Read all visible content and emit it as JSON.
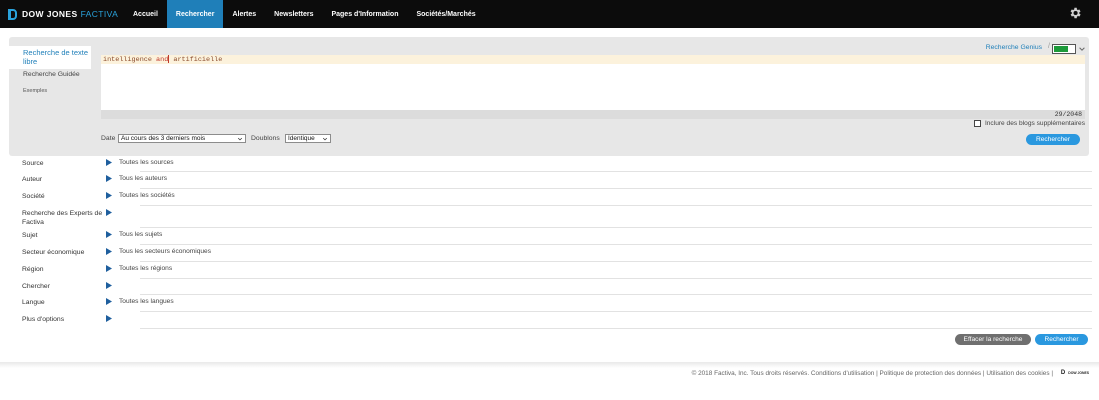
{
  "brand": {
    "name": "DOW JONES",
    "product": "FACTIVA"
  },
  "nav": {
    "items": [
      {
        "label": "Accueil"
      },
      {
        "label": "Rechercher",
        "active": true
      },
      {
        "label": "Alertes"
      },
      {
        "label": "Newsletters"
      },
      {
        "label": "Pages d'Information"
      },
      {
        "label": "Sociétés/Marchés"
      }
    ],
    "settings_icon": "gear-icon"
  },
  "search_panel": {
    "tabs": {
      "free_text": "Recherche de texte libre",
      "guided": "Recherche Guidée",
      "examples": "Exemples"
    },
    "genius_label": "Recherche Genius",
    "genius_separator": "/",
    "genius_enabled": true,
    "query": {
      "part1": "intelligence ",
      "operator": "and",
      "part2": " artificielle"
    },
    "char_counter": "29/2048",
    "include_blogs_label": "Inclure des blogs supplémentaires",
    "include_blogs_checked": false,
    "date_label": "Date",
    "date_value": "Au cours des 3 derniers mois",
    "duplicates_label": "Doublons",
    "duplicates_value": "Identique",
    "search_button": "Rechercher"
  },
  "criteria": [
    {
      "label": "Source",
      "value": "Toutes les sources"
    },
    {
      "label": "Auteur",
      "value": "Tous les auteurs"
    },
    {
      "label": "Société",
      "value": "Toutes les sociétés"
    },
    {
      "label": "Recherche des Experts de Factiva",
      "value": ""
    },
    {
      "label": "Sujet",
      "value": "Tous les sujets"
    },
    {
      "label": "Secteur économique",
      "value": "Tous les secteurs économiques"
    },
    {
      "label": "Région",
      "value": "Toutes les régions"
    },
    {
      "label": "Chercher",
      "value": ""
    },
    {
      "label": "Langue",
      "value": "Toutes les langues"
    },
    {
      "label": "Plus d'options",
      "value": ""
    }
  ],
  "actions": {
    "clear": "Effacer la recherche",
    "search": "Rechercher"
  },
  "footer": {
    "text": "© 2018 Factiva, Inc. Tous droits réservés.  Conditions d'utilisation | Politique de protection des données | Utilisation des cookies |",
    "logo_mark": "D",
    "logo_text": "DOW JONES"
  },
  "colors": {
    "accent": "#1f7fb9",
    "button_blue": "#2a98df",
    "toggle_on": "#1c9a3a",
    "topbar": "#0c0c0c"
  }
}
